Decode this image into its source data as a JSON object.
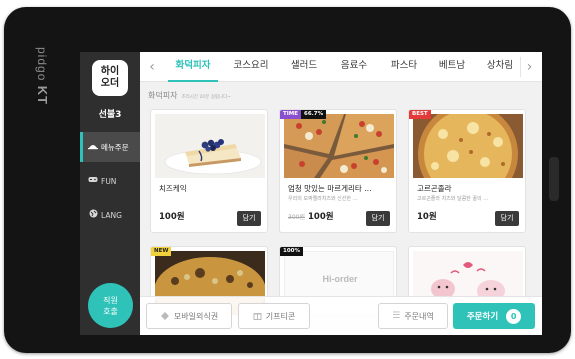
{
  "device": {
    "brand_small": "pidgo",
    "brand_big": "KT"
  },
  "sidebar": {
    "logo": "하이\n오더",
    "logo_line1": "하이",
    "logo_line2": "오더",
    "table_name": "선불3",
    "items": [
      {
        "label": "메뉴주문",
        "icon": "dish-icon",
        "active": true
      },
      {
        "label": "FUN",
        "icon": "game-controller-icon",
        "active": false
      },
      {
        "label": "LANG",
        "icon": "globe-icon",
        "active": false
      }
    ],
    "call_staff_line1": "직원",
    "call_staff_line2": "호출"
  },
  "tabs": [
    "화덕피자",
    "코스요리",
    "샐러드",
    "음료수",
    "파스타",
    "베트남",
    "상차림"
  ],
  "active_tab": "화덕피자",
  "category": {
    "title": "화덕피자",
    "note": "조리시간 20분 걸립니다~"
  },
  "menu_cards": [
    {
      "name": "치즈케익",
      "desc": "",
      "price": "100원",
      "old_price": "",
      "button": "담기",
      "badges": []
    },
    {
      "name": "엄청 맛있는 마르게리타 …",
      "desc": "우리의 모짜렐라치즈와 신선한 …",
      "price": "100원",
      "old_price": "300원",
      "button": "담기",
      "badges": [
        "TIME",
        "66.7%"
      ]
    },
    {
      "name": "고르곤졸라",
      "desc": "고르곤졸라 치즈와 달콤한 꿀의 …",
      "price": "10원",
      "old_price": "",
      "button": "담기",
      "badges": [
        "BEST"
      ]
    }
  ],
  "second_row": [
    {
      "badge": "NEW",
      "placeholder": ""
    },
    {
      "badge": "100%",
      "placeholder": "Hi-order"
    },
    {
      "badge": "",
      "placeholder": ""
    }
  ],
  "bottom_bar": {
    "mobile_voucher": "모바일외식권",
    "gifticon": "기프티콘",
    "order_history": "주문내역",
    "order_button": "주문하기",
    "order_count": "0"
  },
  "colors": {
    "accent": "#2ec2b8",
    "sidebar": "#2f2f2f",
    "bezel": "#141414"
  }
}
